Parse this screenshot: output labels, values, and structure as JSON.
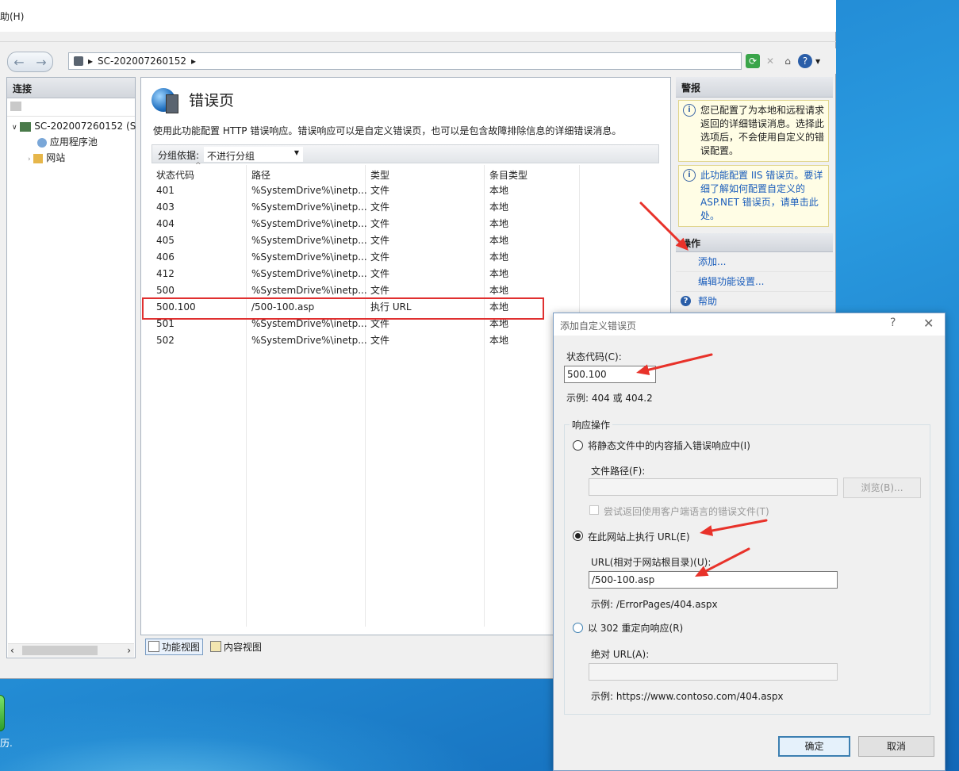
{
  "menu": {
    "help": "助(H)"
  },
  "address": {
    "host": "SC-202007260152"
  },
  "connections": {
    "title": "连接",
    "tree": {
      "server": "SC-202007260152 (S",
      "app_pools": "应用程序池",
      "sites": "网站"
    }
  },
  "feature": {
    "title": "错误页",
    "description": "使用此功能配置 HTTP 错误响应。错误响应可以是自定义错误页，也可以是包含故障排除信息的详细错误消息。",
    "group_label": "分组依据:",
    "group_value": "不进行分组",
    "columns": [
      "状态代码",
      "路径",
      "类型",
      "条目类型"
    ],
    "rows": [
      [
        "401",
        "%SystemDrive%\\inetp...",
        "文件",
        "本地"
      ],
      [
        "403",
        "%SystemDrive%\\inetp...",
        "文件",
        "本地"
      ],
      [
        "404",
        "%SystemDrive%\\inetp...",
        "文件",
        "本地"
      ],
      [
        "405",
        "%SystemDrive%\\inetp...",
        "文件",
        "本地"
      ],
      [
        "406",
        "%SystemDrive%\\inetp...",
        "文件",
        "本地"
      ],
      [
        "412",
        "%SystemDrive%\\inetp...",
        "文件",
        "本地"
      ],
      [
        "500",
        "%SystemDrive%\\inetp...",
        "文件",
        "本地"
      ],
      [
        "500.100",
        "/500-100.asp",
        "执行 URL",
        "本地"
      ],
      [
        "501",
        "%SystemDrive%\\inetp...",
        "文件",
        "本地"
      ],
      [
        "502",
        "%SystemDrive%\\inetp...",
        "文件",
        "本地"
      ]
    ],
    "view_tabs": {
      "features": "功能视图",
      "content": "内容视图"
    }
  },
  "alerts": {
    "title": "警报",
    "alert1": "您已配置了为本地和远程请求返回的详细错误消息。选择此选项后，不会使用自定义的错误配置。",
    "alert2": "此功能配置 IIS 错误页。要详细了解如何配置自定义的 ASP.NET 错误页，请单击此处。"
  },
  "actions": {
    "title": "操作",
    "add": "添加...",
    "edit": "编辑功能设置...",
    "help": "帮助"
  },
  "dialog": {
    "title": "添加自定义错误页",
    "help_glyph": "?",
    "close_glyph": "✕",
    "status_label": "状态代码(C):",
    "status_value": "500.100",
    "status_example": "示例: 404 或 404.2",
    "group_title": "响应操作",
    "opt_static": "将静态文件中的内容插入错误响应中(I)",
    "file_path_label": "文件路径(F):",
    "file_path_value": "",
    "browse": "浏览(B)...",
    "localized": "尝试返回使用客户端语言的错误文件(T)",
    "opt_execute": "在此网站上执行 URL(E)",
    "url_label": "URL(相对于网站根目录)(U):",
    "url_value": "/500-100.asp",
    "url_example": "示例: /ErrorPages/404.aspx",
    "opt_redirect": "以 302 重定向响应(R)",
    "abs_url_label": "绝对 URL(A):",
    "abs_url_value": "",
    "abs_example": "示例: https://www.contoso.com/404.aspx",
    "ok": "确定",
    "cancel": "取消"
  },
  "desktop": {
    "icon_text": "历."
  },
  "colors": {
    "highlight_box": "#e03030",
    "arrow": "#e8322a",
    "link": "#1a5dbb"
  }
}
